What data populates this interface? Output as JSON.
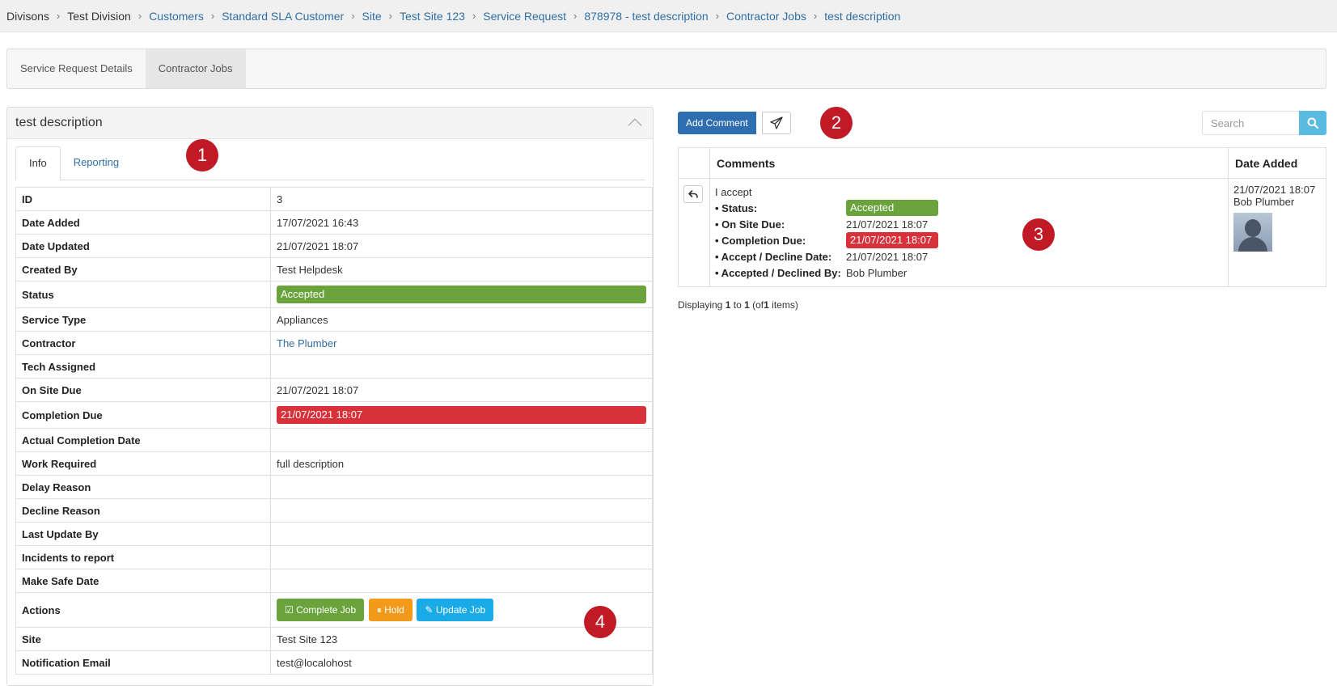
{
  "breadcrumb": [
    "Divisons",
    "Test Division",
    "Customers",
    "Standard SLA Customer",
    "Site",
    "Test Site 123",
    "Service Request",
    "878978 - test description",
    "Contractor Jobs",
    "test description"
  ],
  "top_tabs": [
    "Service Request Details",
    "Contractor Jobs"
  ],
  "panel": {
    "title": "test description",
    "tabs": [
      "Info",
      "Reporting"
    ]
  },
  "info": {
    "labels": {
      "id": "ID",
      "date_added": "Date Added",
      "date_updated": "Date Updated",
      "created_by": "Created By",
      "status": "Status",
      "service_type": "Service Type",
      "contractor": "Contractor",
      "tech_assigned": "Tech Assigned",
      "on_site_due": "On Site Due",
      "completion_due": "Completion Due",
      "actual_completion_date": "Actual Completion Date",
      "work_required": "Work Required",
      "delay_reason": "Delay Reason",
      "decline_reason": "Decline Reason",
      "last_update_by": "Last Update By",
      "incidents_to_report": "Incidents to report",
      "make_safe_date": "Make Safe Date",
      "actions": "Actions",
      "site": "Site",
      "notification_email": "Notification Email"
    },
    "values": {
      "id": "3",
      "date_added": "17/07/2021 16:43",
      "date_updated": "21/07/2021 18:07",
      "created_by": "Test Helpdesk",
      "status": "Accepted",
      "service_type": "Appliances",
      "contractor": "The Plumber",
      "on_site_due": "21/07/2021 18:07",
      "completion_due": "21/07/2021 18:07",
      "work_required": "full description",
      "site": "Test Site 123",
      "notification_email": "test@localohost"
    },
    "actions": {
      "complete": "Complete Job",
      "hold": "Hold",
      "update": "Update Job"
    }
  },
  "markers": [
    "1",
    "2",
    "3",
    "4"
  ],
  "comments": {
    "add_label": "Add Comment",
    "search_placeholder": "Search",
    "headers": {
      "comments": "Comments",
      "date_added": "Date Added"
    },
    "row": {
      "text": "I accept",
      "status_label": "• Status:",
      "status_value": "Accepted",
      "on_site_label": "• On Site Due:",
      "on_site_value": "21/07/2021 18:07",
      "completion_label": "• Completion Due:",
      "completion_value": "21/07/2021 18:07",
      "accept_date_label": "• Accept / Decline Date:",
      "accept_date_value": "21/07/2021 18:07",
      "accepted_by_label": "• Accepted / Declined By:",
      "accepted_by_value": "Bob Plumber",
      "date": "21/07/2021 18:07",
      "author": "Bob Plumber"
    },
    "pager": {
      "prefix": "Displaying",
      "from": "1",
      "to_word": "to",
      "to": "1",
      "of_prefix": "(of",
      "total": "1",
      "suffix": "items)"
    }
  },
  "colors": {
    "accepted": "#6aa23c",
    "overdue": "#d8313a",
    "primary": "#2f6db1",
    "hold": "#f39a1b",
    "update": "#1aaae8"
  }
}
